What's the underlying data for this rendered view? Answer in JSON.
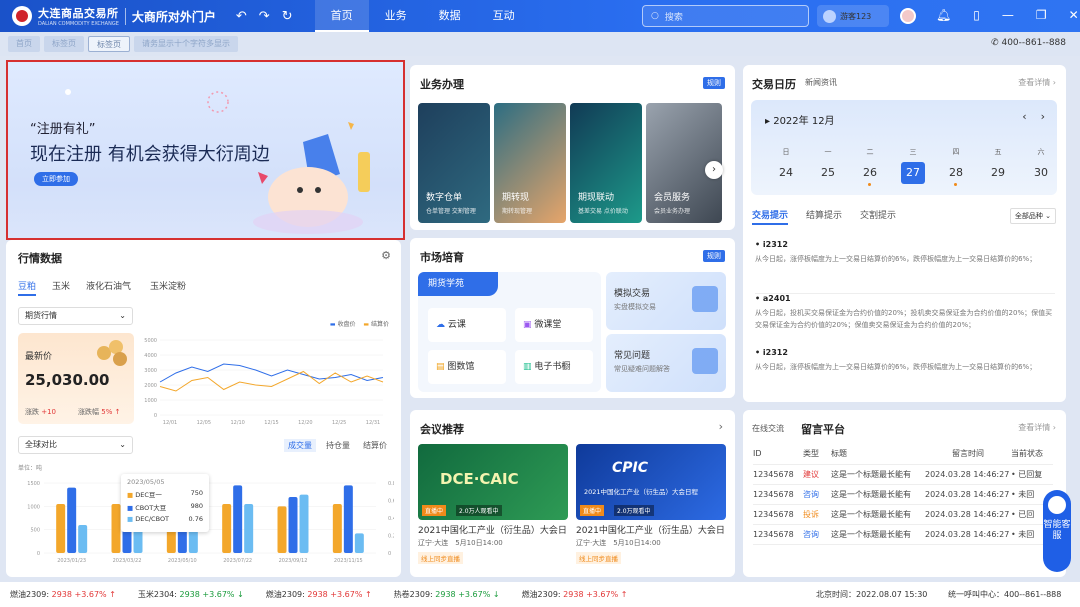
{
  "topbar": {
    "org_name": "大连商品交易所",
    "org_sub": "DALIAN COMMODITY EXCHANGE",
    "portal": "大商所对外门户",
    "nav": [
      "首页",
      "业务",
      "数据",
      "互动"
    ],
    "search_placeholder": "搜索",
    "user": "游客123"
  },
  "subtabs": [
    "首页",
    "标签页",
    "标签页",
    "请务显示十个字符多显示"
  ],
  "phone": "400--861--888",
  "banner": {
    "line1": "“注册有礼”",
    "line2": "现在注册 有机会获得大衍周边",
    "button": "立即参加"
  },
  "business": {
    "title": "业务办理",
    "tag": "规则",
    "items": [
      {
        "name": "数字仓单",
        "desc": "仓单管理 交割管理",
        "color": "#24506c"
      },
      {
        "name": "期转现",
        "desc": "期转现管理",
        "color": "#3a7486"
      },
      {
        "name": "期现联动",
        "desc": "基差交易 点价联动",
        "color": "#1b6a84"
      },
      {
        "name": "会员服务",
        "desc": "会员业务办理",
        "color": "#5a6370"
      }
    ]
  },
  "calendar": {
    "tabs": [
      "交易日历",
      "新闻资讯"
    ],
    "more": "查看详情",
    "month": "2022年 12月",
    "weekdays": [
      "日",
      "一",
      "二",
      "三",
      "四",
      "五",
      "六"
    ],
    "days": [
      "24",
      "25",
      "26",
      "27",
      "28",
      "29",
      "30"
    ],
    "today_index": 3
  },
  "tips": {
    "tabs": [
      "交易提示",
      "结算提示",
      "交割提示"
    ],
    "filter": "全部品种",
    "items": [
      {
        "code": "i2312",
        "text": "从今日起，涨停板幅度为上一交易日结算价的6%，跌停板幅度为上一交易日结算价的6%；"
      },
      {
        "code": "a2401",
        "text": "从今日起，投机买交易保证金为合约价值的20%；投机卖交易保证金为合约价值的20%；保值买交易保证金为合约价值的20%；保值卖交易保证金为合约价值的20%；"
      },
      {
        "code": "i2312",
        "text": "从今日起，涨停板幅度为上一交易日结算价的6%，跌停板幅度为上一交易日结算价的6%；"
      }
    ]
  },
  "market": {
    "title": "行情数据",
    "tabs": [
      "豆粕",
      "玉米",
      "液化石油气",
      "玉米淀粉"
    ],
    "select": "期货行情",
    "legend": [
      "收盘价",
      "结算价"
    ],
    "latest_label": "最新价",
    "latest_value": "25,030.00",
    "change_label": "涨跌",
    "change_value": "+10",
    "pct_label": "涨跌幅",
    "pct_value": "5%",
    "compare_select": "全球对比",
    "compare_tabs": [
      "成交量",
      "持仓量",
      "结算价"
    ],
    "unit": "单位：吨",
    "tooltip": {
      "date": "2023/05/05",
      "rows": [
        {
          "name": "DEC豆一",
          "value": "750",
          "color": "#f3a72b"
        },
        {
          "name": "CBOT大豆",
          "value": "980",
          "color": "#2f6ee8"
        },
        {
          "name": "DEC/CBOT",
          "value": "0.76",
          "color": "#6bbcf2"
        }
      ]
    }
  },
  "chart_data": [
    {
      "type": "line",
      "x": [
        "12/01",
        "12/05",
        "12/10",
        "12/15",
        "12/20",
        "12/25",
        "12/31"
      ],
      "ylim": [
        0,
        5000
      ],
      "yticks": [
        "5000",
        "4000",
        "3000",
        "2000",
        "1000",
        "0"
      ],
      "series": [
        {
          "name": "收盘价",
          "values": [
            2200,
            2800,
            3200,
            2900,
            3400,
            3300,
            3000,
            2600,
            3000,
            2700,
            2400,
            2500,
            2700,
            2300,
            2500
          ]
        },
        {
          "name": "结算价",
          "values": [
            1900,
            1600,
            2300,
            2500,
            1700,
            2200,
            2000,
            1900,
            2400,
            2900,
            2100,
            2800,
            2200,
            2600,
            2200
          ]
        }
      ]
    },
    {
      "type": "bar",
      "categories": [
        "2023/01/23",
        "2023/03/22",
        "2023/05/10",
        "2023/07/22",
        "2023/09/12",
        "2023/11/15"
      ],
      "ylim": [
        0,
        1500
      ],
      "yticks": [
        "1500",
        "1000",
        "500",
        "0"
      ],
      "y2ticks": [
        "0.8",
        "0.6",
        "0.4",
        "0.2",
        "0"
      ],
      "series": [
        {
          "name": "DEC豆一",
          "values": [
            1050,
            1050,
            1300,
            1050,
            1000,
            1050
          ]
        },
        {
          "name": "CBOT大豆",
          "values": [
            1400,
            700,
            1100,
            1450,
            1200,
            1450
          ]
        },
        {
          "name": "DEC/CBOT",
          "values": [
            600,
            850,
            500,
            1050,
            1250,
            420
          ]
        }
      ]
    }
  ],
  "training": {
    "title": "市场培育",
    "tag": "规则",
    "school": "期货学苑",
    "items": [
      "云课",
      "微课堂",
      "图数馆",
      "电子书橱"
    ],
    "side": [
      {
        "name": "模拟交易",
        "desc": "实盘模拟交易"
      },
      {
        "name": "常见问题",
        "desc": "常见疑难问题解答"
      }
    ]
  },
  "conference": {
    "title": "会议推荐",
    "items": [
      {
        "banner": "DCE·CAIC",
        "live": "直播中",
        "viewers": "2.0万人观看中",
        "name": "2021中国化工产业（衍生品）大会日",
        "meta": "辽宁·大连　5月10日14:00",
        "tag": "线上同步直播"
      },
      {
        "banner": "CPIC",
        "sub": "2021中国化工产业（衍生品）大会日程",
        "live": "直播中",
        "viewers": "2.0万观看中",
        "name": "2021中国化工产业（衍生品）大会日",
        "meta": "辽宁·大连　5月10日14:00",
        "tag": "线上同步直播"
      }
    ]
  },
  "messages": {
    "tabs": [
      "在线交流",
      "留言平台"
    ],
    "more": "查看详情",
    "headers": [
      "ID",
      "类型",
      "标题",
      "留言时间",
      "当前状态"
    ],
    "rows": [
      {
        "id": "12345678",
        "type": "建议",
        "type_color": "#e23838",
        "title": "这是一个标题最长能有",
        "time": "2024.03.28 14:46:27",
        "status": "已回复"
      },
      {
        "id": "12345678",
        "type": "咨询",
        "type_color": "#2f6ee8",
        "title": "这是一个标题最长能有",
        "time": "2024.03.28 14:46:27",
        "status": "未回"
      },
      {
        "id": "12345678",
        "type": "投诉",
        "type_color": "#f08a1a",
        "title": "这是一个标题最长能有",
        "time": "2024.03.28 14:46:27",
        "status": "已回"
      },
      {
        "id": "12345678",
        "type": "咨询",
        "type_color": "#2f6ee8",
        "title": "这是一个标题最长能有",
        "time": "2024.03.28 14:46:27",
        "status": "未回"
      }
    ]
  },
  "service": "智能客服",
  "ticker": {
    "items": [
      {
        "name": "燃油2309:",
        "price": "2938",
        "pct": "+3.67%",
        "dir": "↑",
        "up": true
      },
      {
        "name": "玉米2304:",
        "price": "2938",
        "pct": "+3.67%",
        "dir": "↓",
        "up": false
      },
      {
        "name": "燃油2309:",
        "price": "2938",
        "pct": "+3.67%",
        "dir": "↑",
        "up": true
      },
      {
        "name": "热卷2309:",
        "price": "2938",
        "pct": "+3.67%",
        "dir": "↓",
        "up": false
      },
      {
        "name": "燃油2309:",
        "price": "2938",
        "pct": "+3.67%",
        "dir": "↑",
        "up": true
      }
    ],
    "time": "北京时间：2022.08.07  15:30",
    "hotline": "统一呼叫中心：400--861--888"
  }
}
